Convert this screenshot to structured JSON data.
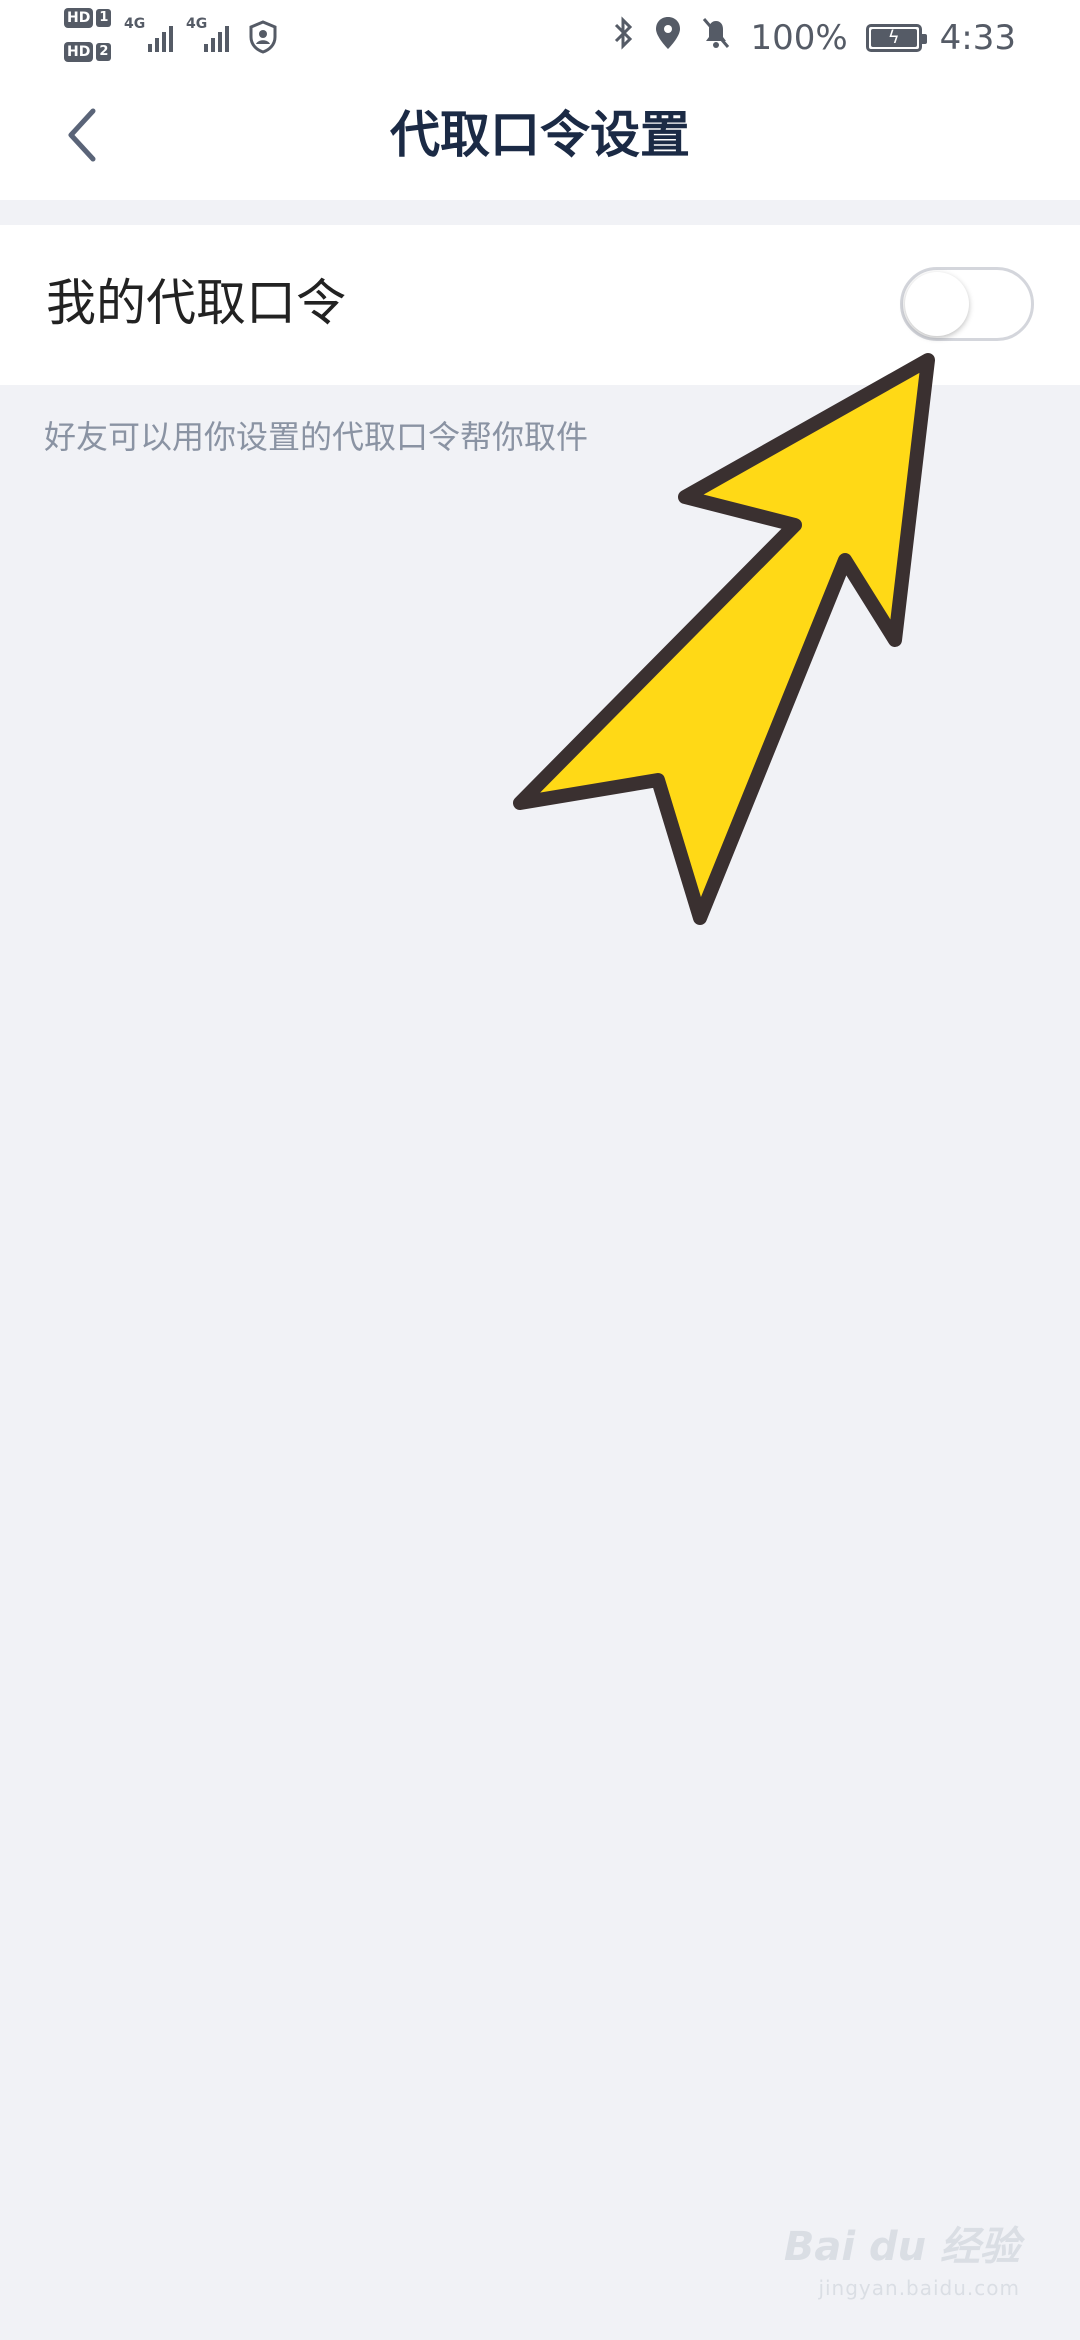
{
  "status_bar": {
    "sim1_label": "HD",
    "sim1_num": "1",
    "sim2_label": "HD",
    "sim2_num": "2",
    "network1": "4G",
    "network2": "4G",
    "battery": "100%",
    "time": "4:33"
  },
  "header": {
    "title": "代取口令设置"
  },
  "setting": {
    "label": "我的代取口令",
    "enabled": false
  },
  "hint": "好友可以用你设置的代取口令帮你取件",
  "watermark": {
    "brand": "Bai du 经验",
    "url": "jingyan.baidu.com"
  },
  "colors": {
    "title": "#1b2a45",
    "background": "#f1f2f6",
    "arrow_fill": "#ffd916",
    "arrow_stroke": "#3a3030"
  }
}
